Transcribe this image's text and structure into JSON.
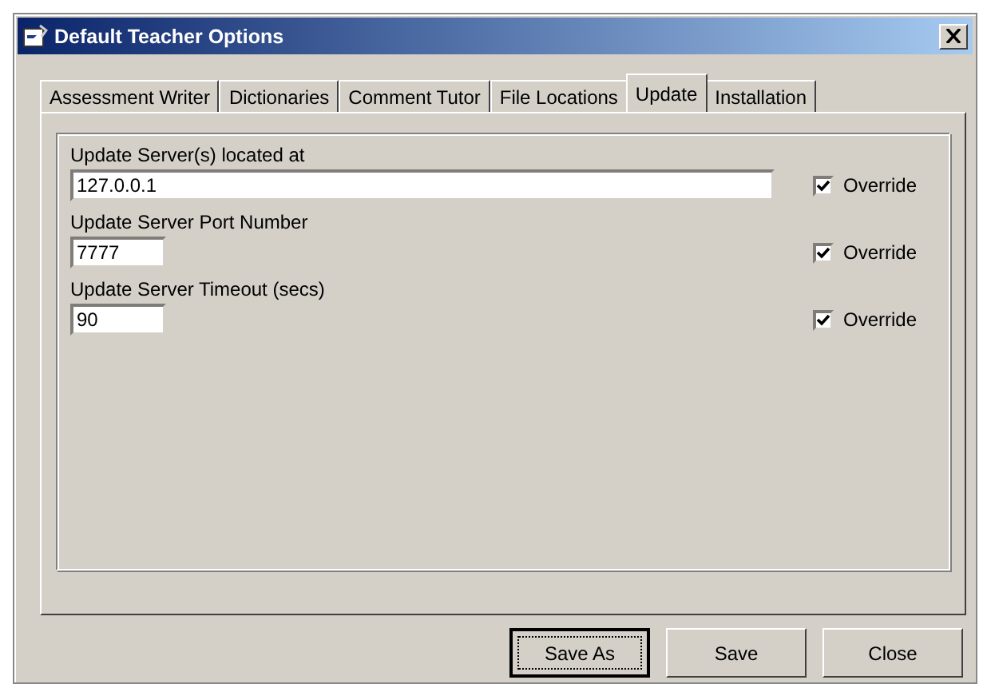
{
  "window": {
    "title": "Default Teacher Options"
  },
  "tabs": [
    {
      "label": "Assessment Writer",
      "selected": false
    },
    {
      "label": "Dictionaries",
      "selected": false
    },
    {
      "label": "Comment Tutor",
      "selected": false
    },
    {
      "label": "File Locations",
      "selected": false
    },
    {
      "label": "Update",
      "selected": true
    },
    {
      "label": "Installation",
      "selected": false
    }
  ],
  "settings": [
    {
      "label": "Update Server(s) located at",
      "value": "127.0.0.1",
      "kind": "wide",
      "override": {
        "label": "Override",
        "checked": true
      }
    },
    {
      "label": "Update Server Port Number",
      "value": "7777",
      "kind": "short",
      "override": {
        "label": "Override",
        "checked": true
      }
    },
    {
      "label": "Update Server Timeout (secs)",
      "value": "90",
      "kind": "short",
      "override": {
        "label": "Override",
        "checked": true
      }
    }
  ],
  "buttons": [
    {
      "label": "Save As",
      "focused": true
    },
    {
      "label": "Save",
      "focused": false
    },
    {
      "label": "Close",
      "focused": false
    }
  ]
}
